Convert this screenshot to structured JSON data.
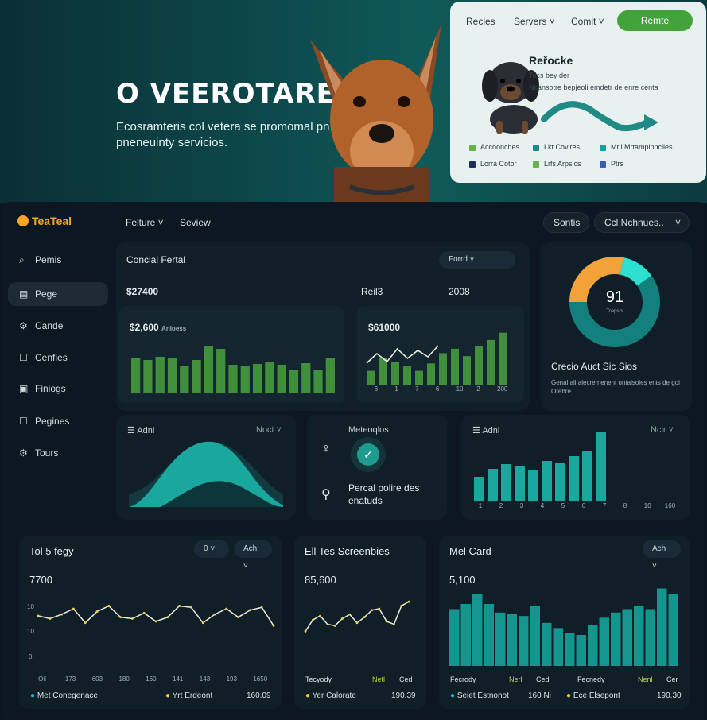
{
  "hero": {
    "title": "O VEEROTARE",
    "subtitle": "Ecosramteris col vetera se promomal pn pneneuinty servicios."
  },
  "top_card": {
    "nav": [
      "Recles",
      "Servers ˅",
      "Comit ˅"
    ],
    "cta": "Remte",
    "title": "Reřocke",
    "line1": "Tocs bey der",
    "line2": "Ncansotre bepjeoli emdetr de enre centa",
    "legend": [
      {
        "label": "Accoonches",
        "color": "#6ab04c"
      },
      {
        "label": "Lkt Covires",
        "color": "#1a8a8a"
      },
      {
        "label": "Mril Mrtampipnclies",
        "color": "#16a0a0"
      },
      {
        "label": "Lorra Cotor",
        "color": "#1e2f5a"
      },
      {
        "label": "Lrfs Arpsics",
        "color": "#6ab04c"
      },
      {
        "label": "Ptrs",
        "color": "#3b5fb0"
      }
    ]
  },
  "topbar": {
    "logo": "TeaTeal",
    "nav1": "Felture ˅",
    "nav2": "Seview",
    "pill1": "Sontis",
    "pill2": "Ccl Nchnues..",
    "pill2_caret": "˅"
  },
  "sidebar": [
    {
      "label": "Pemis",
      "icon": "⌕"
    },
    {
      "label": "Pege",
      "icon": "▤"
    },
    {
      "label": "Cande",
      "icon": "⚙"
    },
    {
      "label": "Cenfies",
      "icon": "☐"
    },
    {
      "label": "Finiogs",
      "icon": "▣"
    },
    {
      "label": "Pegines",
      "icon": "☐"
    },
    {
      "label": "Tours",
      "icon": "⚙"
    }
  ],
  "panel_top": {
    "title": "Concial Fertal",
    "select": "Forrd ˅",
    "v1": "$27400",
    "v2": "Reil3",
    "v3": "2008"
  },
  "barbox1": {
    "label": "$2,600",
    "sub": "Anloess"
  },
  "barbox2": {
    "label": "$61000",
    "ticks": [
      "6",
      "1",
      "7",
      "6",
      "10",
      "2",
      "200"
    ]
  },
  "donut": {
    "center": "91",
    "center_sub": "Toepsrs",
    "title": "Crecio Auct Sic Sios",
    "desc": "Genal ali alecremenent ontaisoles ents de goi Orebre"
  },
  "area_panel": {
    "title": "Adnl",
    "select": "Noct ˅"
  },
  "mid_panel": {
    "title": "Meteoqlos",
    "text": "Percal polire des enatuds"
  },
  "bars_panel": {
    "title": "Adnl",
    "select": "Ncir ˅",
    "ticks": [
      "1",
      "2",
      "3",
      "4",
      "5",
      "6",
      "7",
      "8",
      "10",
      "160"
    ]
  },
  "bottom1": {
    "title": "Tol 5 fegy",
    "select_a": "0 ˅",
    "select_b": "Ach ˅",
    "value": "7700",
    "y_ticks": [
      "10",
      "10",
      "0"
    ],
    "x_ticks": [
      "Oil",
      "173",
      "603",
      "180",
      "160",
      "141",
      "143",
      "193",
      "1650"
    ],
    "footer_left": "Met Conegenace",
    "footer_mid": "Yrt Erdeont",
    "footer_right": "160.09"
  },
  "bottom2": {
    "title": "Ell Tes Screenbies",
    "value": "85,600",
    "legend": [
      "Tecyody",
      "Netl",
      "Ced"
    ],
    "footer_left": "Yer Calorate",
    "footer_right": "190.39"
  },
  "bottom3": {
    "title": "Mel Card",
    "select": "Ach ˅",
    "value": "5,100",
    "legend": [
      "Fecrody",
      "Nerl",
      "Ced",
      "Fecnedy",
      "Nenl",
      "Cer"
    ],
    "footer_left": "Seiet Estnonot",
    "footer_mid": "160 Ni",
    "footer_mid2": "Ece Elsepont",
    "footer_right": "190.30"
  },
  "chart_data": [
    {
      "type": "bar",
      "title": "$2,600",
      "values": [
        44,
        42,
        46,
        44,
        34,
        42,
        60,
        56,
        36,
        34,
        37,
        40,
        36,
        30,
        38,
        30,
        44
      ]
    },
    {
      "type": "bar",
      "title": "$61000",
      "values": [
        20,
        38,
        32,
        26,
        20,
        30,
        44,
        50,
        40,
        54,
        62,
        72
      ],
      "line": [
        28,
        40,
        30,
        46,
        34,
        44,
        36,
        50
      ]
    },
    {
      "type": "pie",
      "values": [
        28,
        12,
        60
      ],
      "colors": [
        "#f3a23a",
        "#2de0d0",
        "#14807e"
      ]
    },
    {
      "type": "area",
      "title": "Adnl"
    },
    {
      "type": "bar",
      "title": "Adnl",
      "values": [
        30,
        40,
        46,
        44,
        38,
        50,
        48,
        56,
        62,
        86
      ]
    },
    {
      "type": "line",
      "title": "Tol 5 fegy",
      "values": [
        62,
        58,
        64,
        72,
        52,
        68,
        76,
        60,
        58,
        66,
        54,
        60,
        76,
        74,
        52,
        64,
        72,
        60,
        70,
        74,
        48
      ]
    },
    {
      "type": "line",
      "title": "Ell Tes Screenbies",
      "values": [
        40,
        56,
        62,
        50,
        48,
        58,
        64,
        52,
        60,
        70,
        72,
        54,
        50,
        76,
        82
      ]
    },
    {
      "type": "bar",
      "title": "Mel Card",
      "values": [
        66,
        72,
        84,
        72,
        62,
        60,
        58,
        70,
        50,
        44,
        38,
        36,
        48,
        56,
        62,
        66,
        70,
        66,
        90,
        84
      ]
    }
  ]
}
